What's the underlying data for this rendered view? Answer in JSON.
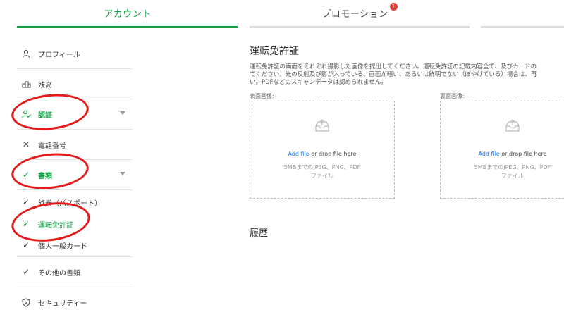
{
  "tabs": {
    "account": "アカウント",
    "promotion": "プロモーション",
    "promotion_badge": "1"
  },
  "sidebar": {
    "profile": "プロフィール",
    "balance": "残高",
    "verification": "認証",
    "phone": "電話番号",
    "documents": "書類",
    "passport": "旅券（パスポート）",
    "license": "運転免許証",
    "id_card": "個人一般カード",
    "other_docs": "その他の書類",
    "security": "セキュリティー"
  },
  "main": {
    "title": "運転免許証",
    "desc_line1": "運転免許証の両面をそれぞれ撮影した画像を提出してください。運転免許証の記載内容全て、及びカードの",
    "desc_line2": "てください。光の反射及び影が入っている、画面が暗い、あるいは鮮明でない（ぼやけている）場合は、再",
    "desc_line3": "い。PDFなどのスキャンデータは認められません。",
    "front_label": "表面画像:",
    "back_label": "裏面画像:",
    "add_file": "Add file",
    "drop_text": " or drop file here",
    "limits_line1": "5MBまでのJPEG、PNG、PDF",
    "limits_line2": "ファイル",
    "history": "履歴"
  },
  "colors": {
    "accent": "#12a146",
    "badge": "#e53935",
    "link": "#1a73e8",
    "annotation": "#e31b1b"
  }
}
